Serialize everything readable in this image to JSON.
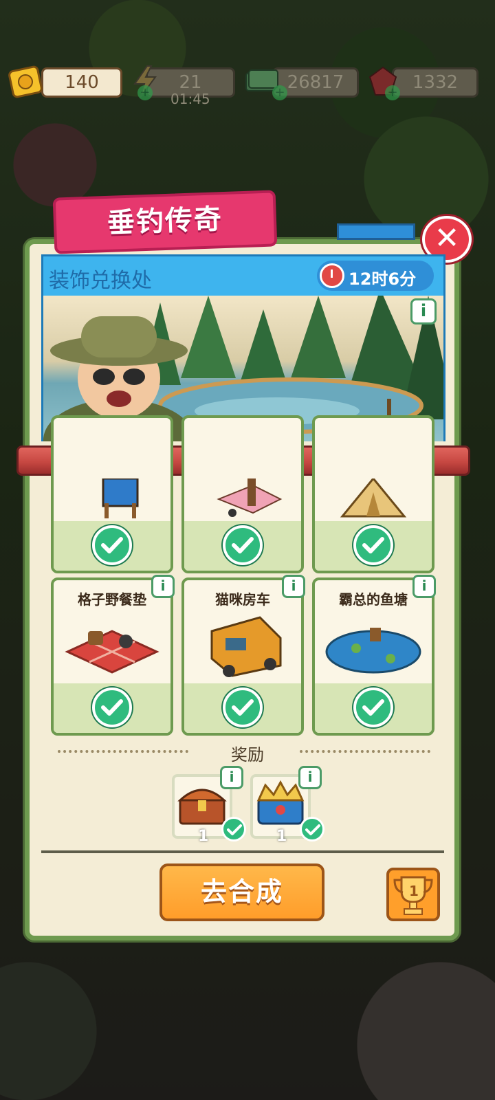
{
  "resources": {
    "tickets": "140",
    "energy": "21",
    "energy_timer": "01:45",
    "cash": "26817",
    "gems": "1332"
  },
  "event": {
    "title": "垂钓传奇",
    "banner_title": "装饰兑换处",
    "time_left": "12时6分"
  },
  "items_row2": [
    {
      "label": "格子野餐垫",
      "info": "i"
    },
    {
      "label": "猫咪房车",
      "info": "i"
    },
    {
      "label": "霸总的鱼塘",
      "info": "i"
    }
  ],
  "rewards": {
    "title": "奖励",
    "items": [
      {
        "name": "chest",
        "count": "1",
        "info": "i"
      },
      {
        "name": "crown-chest",
        "count": "1",
        "info": "i"
      }
    ]
  },
  "actions": {
    "go_merge": "去合成",
    "trophy_rank": "1",
    "close": "✕",
    "scene_info": "i"
  },
  "colors": {
    "panel_border": "#6e9a4f",
    "title_tab": "#e6386e",
    "banner": "#3eb4ee",
    "check": "#2fbb7e",
    "button": "#ff9d2a"
  }
}
